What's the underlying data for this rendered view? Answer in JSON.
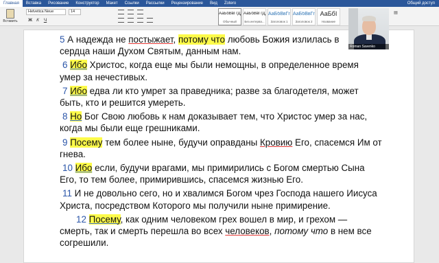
{
  "menu": {
    "tabs": [
      "Главная",
      "Вставка",
      "Рисование",
      "Конструктор",
      "Макет",
      "Ссылки",
      "Рассылки",
      "Рецензирование",
      "Вид",
      "Zotero"
    ],
    "active_tab": "Главная",
    "share_label": "Общий доступ"
  },
  "ribbon": {
    "paste_label": "Вставить",
    "font_name": "Helvetica Neue",
    "font_size": "14",
    "bold": "Ж",
    "italic": "К",
    "underline": "Ч",
    "styles": [
      {
        "preview": "АаБбВвГгДд",
        "name": "Обычный"
      },
      {
        "preview": "АаБбВвГгДд",
        "name": "Без интерва..."
      },
      {
        "preview": "АаБбВвГг",
        "name": "Заголовок 1"
      },
      {
        "preview": "АаБбВвГг",
        "name": "Заголовок 2"
      },
      {
        "preview": "АаБбI",
        "name": "Название"
      }
    ]
  },
  "video": {
    "participant_name": "Roman Savenko"
  },
  "document": {
    "p5": {
      "num": "5",
      "a": " А надежда не ",
      "b": "постыжает",
      "c": ", ",
      "d": "потому что",
      "e": " любовь Божия излилась в",
      "f": "сердца наши Духом Святым, данным нам."
    },
    "p6": {
      "num": "6",
      "word": "Ибо",
      "rest": " Христос, когда еще мы были немощны, в определенное время умер за нечестивых."
    },
    "p7": {
      "num": "7",
      "word": "Ибо",
      "rest": " едва ли кто умрет за праведника; разве за благодетеля, может быть, кто и решится умереть."
    },
    "p8": {
      "num": "8",
      "word": "Но",
      "rest": " Бог Свою любовь к нам доказывает тем, что Христос умер за нас, когда мы были еще грешниками."
    },
    "p9": {
      "num": "9",
      "word": "Посему",
      "a": " тем более ныне, будучи оправданы ",
      "b": "Кровию",
      "c": " Его, спасемся Им от гнева."
    },
    "p10": {
      "num": "10",
      "word": "Ибо",
      "rest": " если, будучи врагами, мы примирились с Богом смертью Сына Его, то тем более, примирившись, спасемся жизнью Его."
    },
    "p11": {
      "num": "11",
      "rest": " И не довольно сего, но и хвалимся Богом чрез Господа нашего Иисуса Христа, посредством Которого мы получили ныне примирение."
    },
    "p12": {
      "num": "12",
      "word": "Посему",
      "a": ", как одним человеком грех вошел в мир, и грехом — смерть, так и смерть перешла во всех ",
      "b": "человеков",
      "c": ", ",
      "d": "потому что",
      "e": " в нем все согрешили."
    }
  }
}
